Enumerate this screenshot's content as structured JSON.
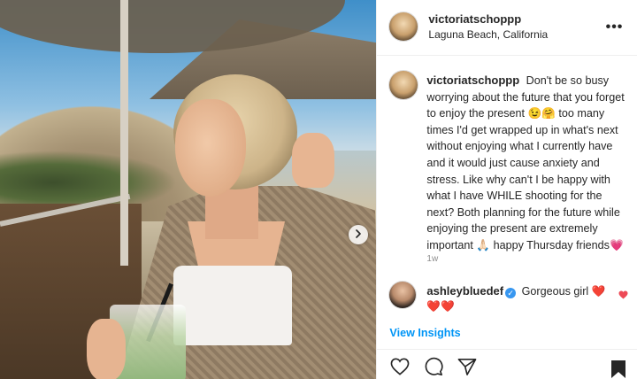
{
  "post": {
    "username": "victoriatschoppp",
    "location": "Laguna Beach, California",
    "more_label": "•••",
    "caption": "Don't be so busy worrying about the future that you forget to enjoy the present 😉🤗 too many times I'd get wrapped up in what's next without enjoying what I currently have and it would just cause anxiety and stress. Like why can't I be happy with what I have WHILE shooting for the next? Both planning for the future while enjoying the present are extremely important 🙏🏻 happy Thursday friends💗",
    "time_ago": "1w"
  },
  "comment": {
    "username": "ashleybluedef",
    "verified_mark": "✓",
    "text": "Gorgeous girl ❤️❤️❤️"
  },
  "footer": {
    "insights_label": "View Insights"
  },
  "icons": {
    "carousel_next": "chevron-right-icon",
    "like": "heart-icon",
    "comment": "comment-icon",
    "share": "paper-plane-icon",
    "save": "bookmark-icon",
    "more": "more-dots-icon",
    "verified": "verified-badge-icon"
  },
  "colors": {
    "link_blue": "#0095f6",
    "verified_blue": "#3897f0",
    "heart_red": "#ed4956",
    "muted_gray": "#8e8e8e"
  }
}
